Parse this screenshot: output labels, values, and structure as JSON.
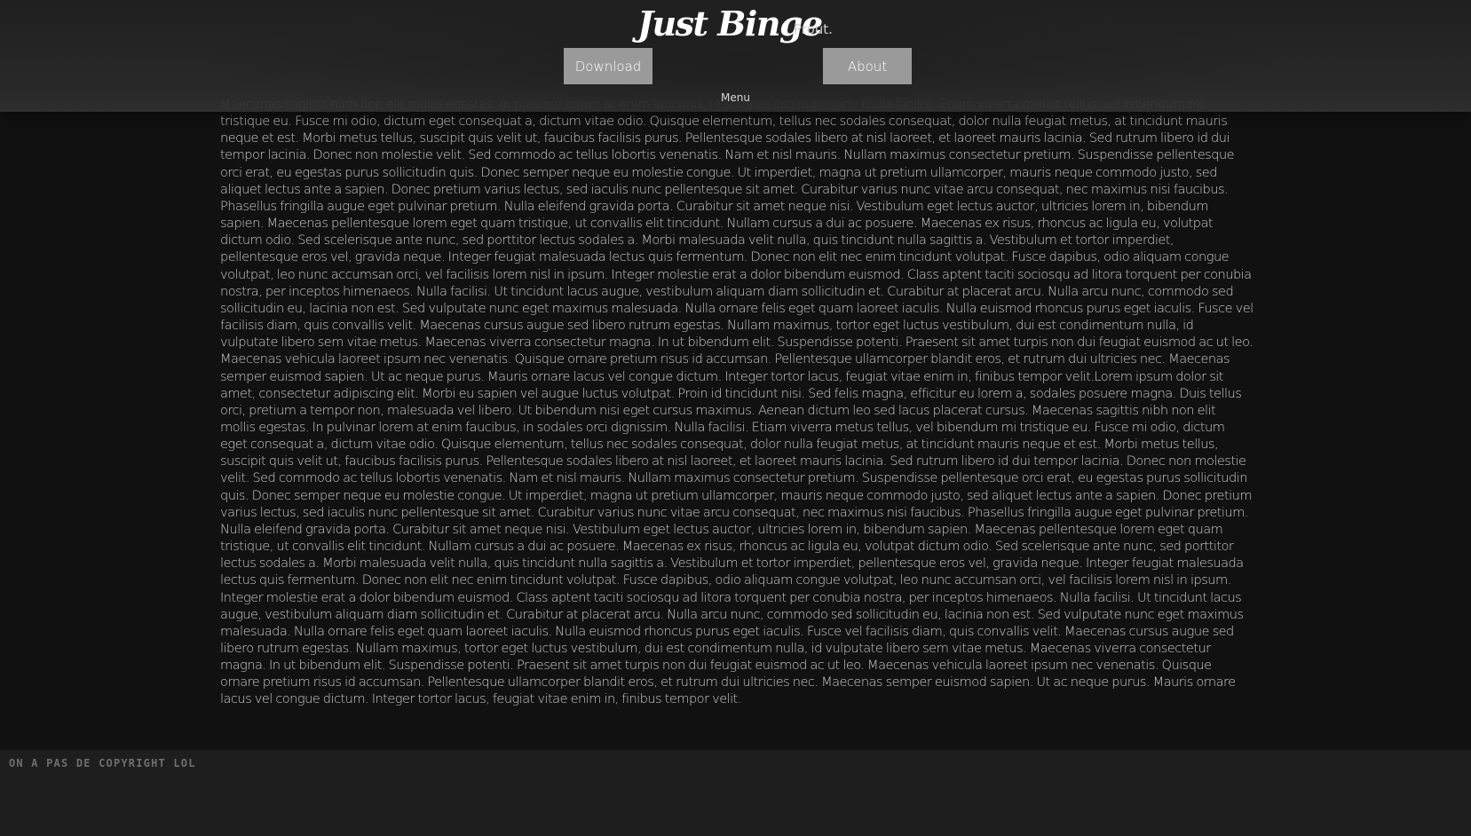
{
  "header": {
    "brand": "Just Binge",
    "tagline": "Prout.",
    "nav": {
      "download_label": "Download",
      "about_label": "About"
    },
    "menu_label": "Menu"
  },
  "main": {
    "paragraph": "Maecenas sagittis nibh non elit mollis egestas. In pulvinar lorem at enim faucibus, in sodales orci dignissim. Nulla facilisi. Etiam viverra metus tellus, vel bibendum mi tristique eu. Fusce mi odio, dictum eget consequat a, dictum vitae odio. Quisque elementum, tellus nec sodales consequat, dolor nulla feugiat metus, at tincidunt mauris neque et est. Morbi metus tellus, suscipit quis velit ut, faucibus facilisis purus. Pellentesque sodales libero at nisl laoreet, et laoreet mauris lacinia. Sed rutrum libero id dui tempor lacinia. Donec non molestie velit. Sed commodo ac tellus lobortis venenatis. Nam et nisl mauris. Nullam maximus consectetur pretium. Suspendisse pellentesque orci erat, eu egestas purus sollicitudin quis. Donec semper neque eu molestie congue. Ut imperdiet, magna ut pretium ullamcorper, mauris neque commodo justo, sed aliquet lectus ante a sapien. Donec pretium varius lectus, sed iaculis nunc pellentesque sit amet. Curabitur varius nunc vitae arcu consequat, nec maximus nisi faucibus. Phasellus fringilla augue eget pulvinar pretium. Nulla eleifend gravida porta. Curabitur sit amet neque nisi. Vestibulum eget lectus auctor, ultricies lorem in, bibendum sapien. Maecenas pellentesque lorem eget quam tristique, ut convallis elit tincidunt. Nullam cursus a dui ac posuere. Maecenas ex risus, rhoncus ac ligula eu, volutpat dictum odio. Sed scelerisque ante nunc, sed porttitor lectus sodales a. Morbi malesuada velit nulla, quis tincidunt nulla sagittis a. Vestibulum et tortor imperdiet, pellentesque eros vel, gravida neque. Integer feugiat malesuada lectus quis fermentum. Donec non elit nec enim tincidunt volutpat. Fusce dapibus, odio aliquam congue volutpat, leo nunc accumsan orci, vel facilisis lorem nisl in ipsum. Integer molestie erat a dolor bibendum euismod. Class aptent taciti sociosqu ad litora torquent per conubia nostra, per inceptos himenaeos. Nulla facilisi. Ut tincidunt lacus augue, vestibulum aliquam diam sollicitudin et. Curabitur at placerat arcu. Nulla arcu nunc, commodo sed sollicitudin eu, lacinia non est. Sed vulputate nunc eget maximus malesuada. Nulla ornare felis eget quam laoreet iaculis. Nulla euismod rhoncus purus eget iaculis. Fusce vel facilisis diam, quis convallis velit. Maecenas cursus augue sed libero rutrum egestas. Nullam maximus, tortor eget luctus vestibulum, dui est condimentum nulla, id vulputate libero sem vitae metus. Maecenas viverra consectetur magna. In ut bibendum elit. Suspendisse potenti. Praesent sit amet turpis non dui feugiat euismod ac ut leo. Maecenas vehicula laoreet ipsum nec venenatis. Quisque ornare pretium risus id accumsan. Pellentesque ullamcorper blandit eros, et rutrum dui ultricies nec. Maecenas semper euismod sapien. Ut ac neque purus. Mauris ornare lacus vel congue dictum. Integer tortor lacus, feugiat vitae enim in, finibus tempor velit.Lorem ipsum dolor sit amet, consectetur adipiscing elit. Morbi eu sapien vel augue luctus volutpat. Proin id tincidunt nisi. Sed felis magna, efficitur eu lorem a, sodales posuere magna. Duis tellus orci, pretium a tempor non, malesuada vel libero. Ut bibendum nisi eget cursus maximus. Aenean dictum leo sed lacus placerat cursus. Maecenas sagittis nibh non elit mollis egestas. In pulvinar lorem at enim faucibus, in sodales orci dignissim. Nulla facilisi. Etiam viverra metus tellus, vel bibendum mi tristique eu. Fusce mi odio, dictum eget consequat a, dictum vitae odio. Quisque elementum, tellus nec sodales consequat, dolor nulla feugiat metus, at tincidunt mauris neque et est. Morbi metus tellus, suscipit quis velit ut, faucibus facilisis purus. Pellentesque sodales libero at nisl laoreet, et laoreet mauris lacinia. Sed rutrum libero id dui tempor lacinia. Donec non molestie velit. Sed commodo ac tellus lobortis venenatis. Nam et nisl mauris. Nullam maximus consectetur pretium. Suspendisse pellentesque orci erat, eu egestas purus sollicitudin quis. Donec semper neque eu molestie congue. Ut imperdiet, magna ut pretium ullamcorper, mauris neque commodo justo, sed aliquet lectus ante a sapien. Donec pretium varius lectus, sed iaculis nunc pellentesque sit amet. Curabitur varius nunc vitae arcu consequat, nec maximus nisi faucibus. Phasellus fringilla augue eget pulvinar pretium. Nulla eleifend gravida porta. Curabitur sit amet neque nisi. Vestibulum eget lectus auctor, ultricies lorem in, bibendum sapien. Maecenas pellentesque lorem eget quam tristique, ut convallis elit tincidunt. Nullam cursus a dui ac posuere. Maecenas ex risus, rhoncus ac ligula eu, volutpat dictum odio. Sed scelerisque ante nunc, sed porttitor lectus sodales a. Morbi malesuada velit nulla, quis tincidunt nulla sagittis a. Vestibulum et tortor imperdiet, pellentesque eros vel, gravida neque. Integer feugiat malesuada lectus quis fermentum. Donec non elit nec enim tincidunt volutpat. Fusce dapibus, odio aliquam congue volutpat, leo nunc accumsan orci, vel facilisis lorem nisl in ipsum. Integer molestie erat a dolor bibendum euismod. Class aptent taciti sociosqu ad litora torquent per conubia nostra, per inceptos himenaeos. Nulla facilisi. Ut tincidunt lacus augue, vestibulum aliquam diam sollicitudin et. Curabitur at placerat arcu. Nulla arcu nunc, commodo sed sollicitudin eu, lacinia non est. Sed vulputate nunc eget maximus malesuada. Nulla ornare felis eget quam laoreet iaculis. Nulla euismod rhoncus purus eget iaculis. Fusce vel facilisis diam, quis convallis velit. Maecenas cursus augue sed libero rutrum egestas. Nullam maximus, tortor eget luctus vestibulum, dui est condimentum nulla, id vulputate libero sem vitae metus. Maecenas viverra consectetur magna. In ut bibendum elit. Suspendisse potenti. Praesent sit amet turpis non dui feugiat euismod ac ut leo. Maecenas vehicula laoreet ipsum nec venenatis. Quisque ornare pretium risus id accumsan. Pellentesque ullamcorper blandit eros, et rutrum dui ultricies nec. Maecenas semper euismod sapien. Ut ac neque purus. Mauris ornare lacus vel congue dictum. Integer tortor lacus, feugiat vitae enim in, finibus tempor velit."
  },
  "footer": {
    "text": "On a pas de copyright lol"
  }
}
